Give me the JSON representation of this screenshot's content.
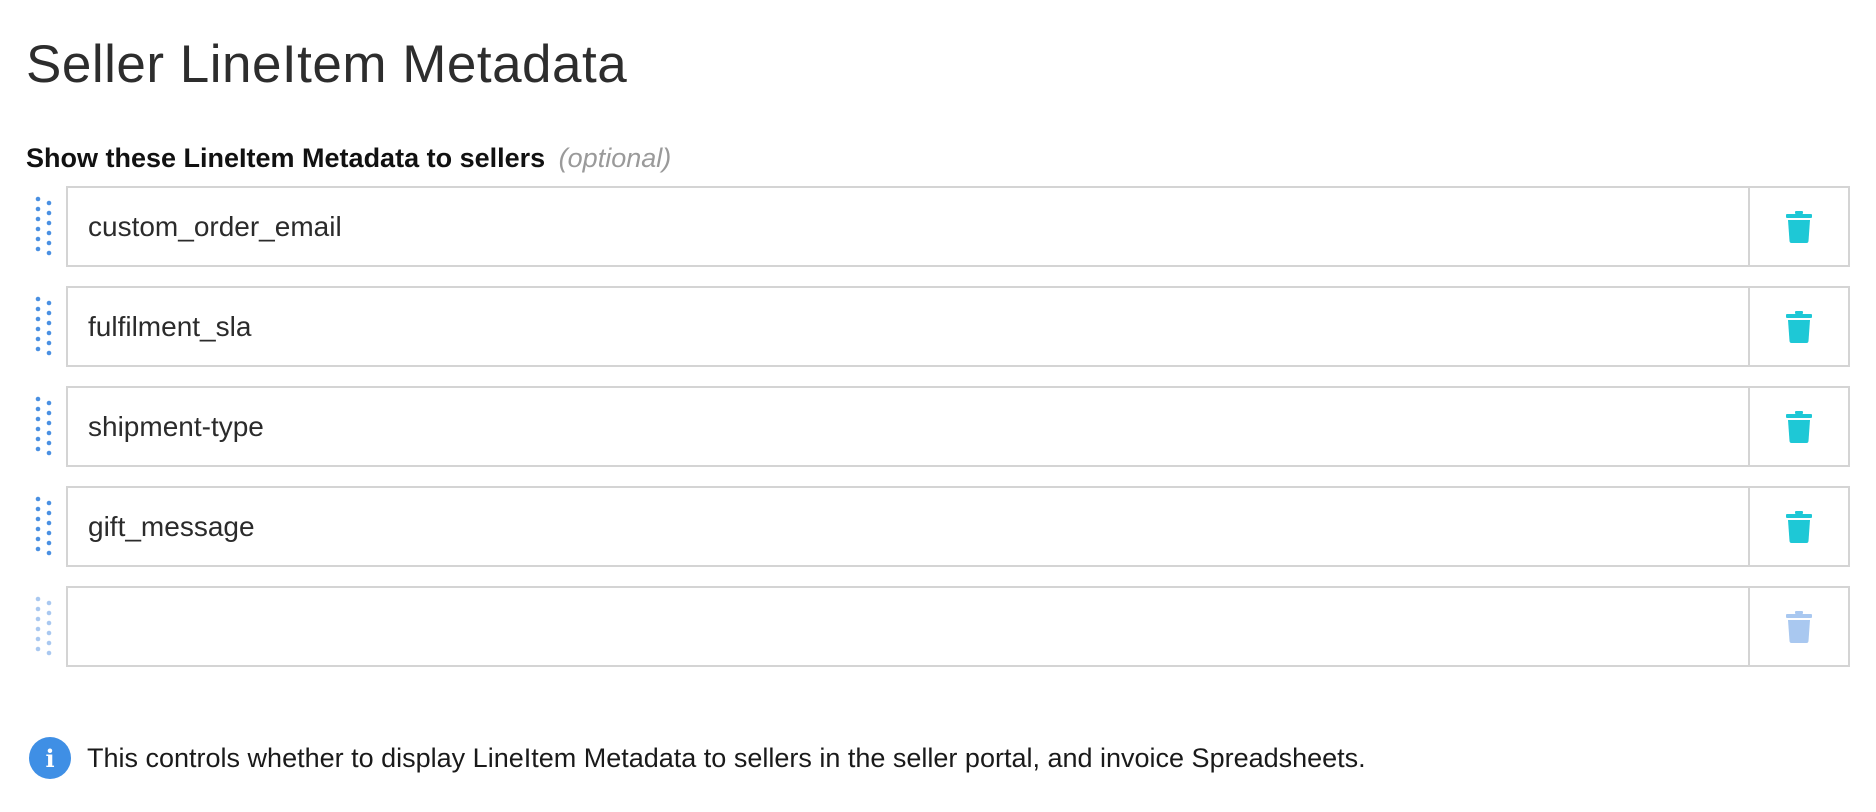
{
  "page": {
    "title": "Seller LineItem Metadata"
  },
  "section": {
    "label": "Show these LineItem Metadata to sellers",
    "optional_label": "(optional)"
  },
  "rows": [
    {
      "value": "custom_order_email",
      "placeholder": "",
      "enabled": true
    },
    {
      "value": "fulfilment_sla",
      "placeholder": "",
      "enabled": true
    },
    {
      "value": "shipment-type",
      "placeholder": "",
      "enabled": true
    },
    {
      "value": "gift_message",
      "placeholder": "",
      "enabled": true
    },
    {
      "value": "",
      "placeholder": "",
      "enabled": false
    }
  ],
  "icons": {
    "drag": "drag-handle-icon",
    "delete": "trash-icon",
    "info": "info-icon"
  },
  "info": {
    "icon_glyph": "i",
    "text": "This controls whether to display LineItem Metadata to sellers in the seller portal, and invoice Spreadsheets."
  },
  "colors": {
    "drag_active": "#4a90e2",
    "drag_inactive": "#a9c8f0",
    "delete_active": "#1ec8d6",
    "delete_inactive": "#a9c8f0",
    "info_accent": "#3f8fe5",
    "border": "#d4d4d4"
  }
}
